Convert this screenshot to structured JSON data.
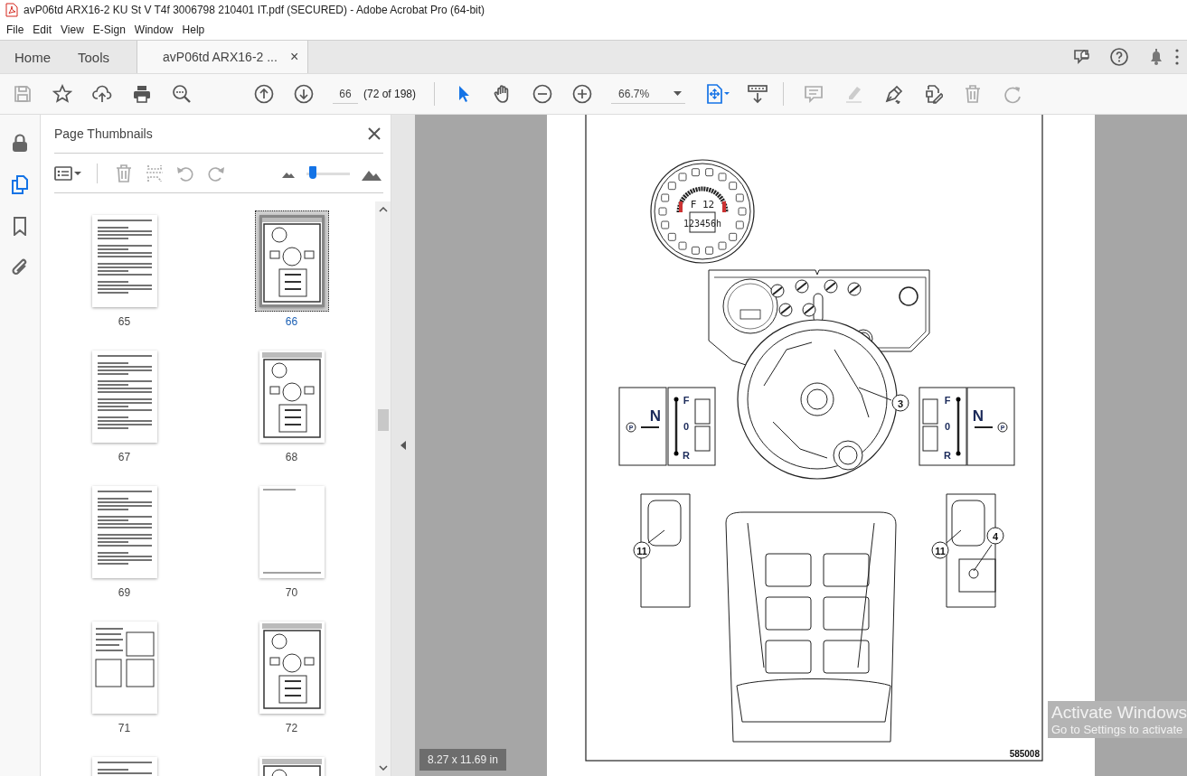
{
  "window": {
    "title": "avP06td ARX16-2 KU St V T4f 3006798 210401 IT.pdf (SECURED) - Adobe Acrobat Pro (64-bit)"
  },
  "menu": [
    "File",
    "Edit",
    "View",
    "E-Sign",
    "Window",
    "Help"
  ],
  "tabs": [
    {
      "label": "Home",
      "selected": false,
      "kind": "nav"
    },
    {
      "label": "Tools",
      "selected": false,
      "kind": "nav"
    },
    {
      "label": "avP06td ARX16-2 ...",
      "selected": true,
      "kind": "document",
      "close": "×"
    }
  ],
  "toolbar": {
    "page_number": "66",
    "page_count": "(72 of 198)",
    "zoom": "66.7%"
  },
  "thumbnails_panel": {
    "title": "Page Thumbnails",
    "slider": {
      "level": 0.15
    },
    "pages": [
      {
        "label": "65",
        "kind": "text",
        "selected": false
      },
      {
        "label": "66",
        "kind": "diagram",
        "selected": true
      },
      {
        "label": "67",
        "kind": "text",
        "selected": false
      },
      {
        "label": "68",
        "kind": "diagram",
        "selected": false
      },
      {
        "label": "69",
        "kind": "text",
        "selected": false
      },
      {
        "label": "70",
        "kind": "blank",
        "selected": false
      },
      {
        "label": "71",
        "kind": "mixed",
        "selected": false
      },
      {
        "label": "72",
        "kind": "diagram",
        "selected": false
      },
      {
        "kind": "text",
        "selected": false
      },
      {
        "kind": "diagram",
        "selected": false
      }
    ]
  },
  "document": {
    "gauge": {
      "gear": "F 12",
      "hours": "123456h"
    },
    "shift_panels": [
      {
        "kind": "left",
        "neutral": "N",
        "park": "P",
        "forward": "F",
        "zero": "0",
        "reverse": "R"
      },
      {
        "kind": "right",
        "neutral": "N",
        "park": "P",
        "forward": "F",
        "zero": "0",
        "reverse": "R"
      }
    ],
    "callouts": [
      {
        "label": "3",
        "kind": "wheel"
      },
      {
        "label": "11",
        "kind": "left-joystick"
      },
      {
        "label": "11",
        "kind": "right-joystick"
      },
      {
        "label": "4",
        "kind": "switch"
      }
    ],
    "figure_number": "585008"
  },
  "page_size": "8.27 x 11.69 in",
  "os_notice": {
    "title": "Activate Windows",
    "text": "Go to Settings to activate"
  }
}
